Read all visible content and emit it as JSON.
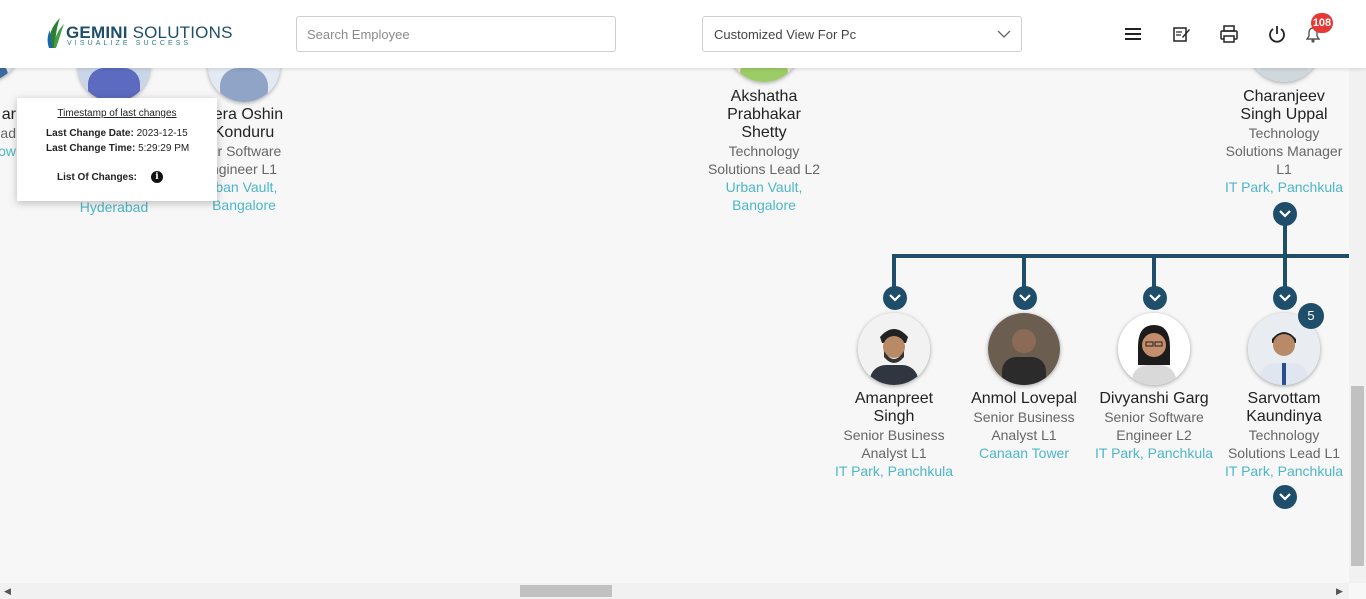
{
  "header": {
    "logo_name_bold": "GEMINI",
    "logo_name_rest": " SOLUTIONS",
    "logo_tagline": "VISUALIZE SUCCESS",
    "search_placeholder": "Search Employee",
    "view_select_value": "Customized View For Pc",
    "notification_count": "108",
    "icons": [
      "menu-icon",
      "edit-note-icon",
      "print-icon",
      "power-icon",
      "bell-icon"
    ]
  },
  "popup": {
    "title": "Timestamp of last changes",
    "date_label": "Last Change Date:",
    "date_value": "2023-12-15",
    "time_label": "Last Change Time:",
    "time_value": "5:29:29 PM",
    "changes_label": "List Of Changes:",
    "info_glyph": "i"
  },
  "top_row": {
    "partial_left": {
      "name": "ar",
      "designation": "ad",
      "location": "ow"
    },
    "hyderabad_location": "Hyderabad",
    "sameera": {
      "name_1": "hera Oshin",
      "name_2": "Konduru",
      "designation_1": "ior Software",
      "designation_2": "ngineer L1",
      "location_1": "rban Vault,",
      "location_2": "Bangalore"
    },
    "akshatha": {
      "name_1": "Akshatha",
      "name_2": "Prabhakar",
      "name_3": "Shetty",
      "designation_1": "Technology",
      "designation_2": "Solutions Lead L2",
      "location_1": "Urban Vault,",
      "location_2": "Bangalore"
    },
    "charanjeev": {
      "name_1": "Charanjeev",
      "name_2": "Singh Uppal",
      "designation_1": "Technology",
      "designation_2": "Solutions Manager",
      "designation_3": "L1",
      "location": "IT Park, Panchkula"
    }
  },
  "reports": [
    {
      "name_1": "Amanpreet",
      "name_2": "Singh",
      "designation_1": "Senior Business",
      "designation_2": "Analyst L1",
      "location": "IT Park, Panchkula"
    },
    {
      "name_1": "Anmol Lovepal",
      "designation_1": "Senior Business",
      "designation_2": "Analyst L1",
      "location": "Canaan Tower"
    },
    {
      "name_1": "Divyanshi Garg",
      "designation_1": "Senior Software",
      "designation_2": "Engineer L2",
      "location": "IT Park, Panchkula"
    },
    {
      "name_1": "Sarvottam",
      "name_2": "Kaundinya",
      "designation_1": "Technology",
      "designation_2": "Solutions Lead L1",
      "location": "IT Park, Panchkula",
      "report_count": "5"
    }
  ],
  "colors": {
    "connector": "#1f4e6b",
    "location_text": "#4db6c8",
    "badge": "#e53935"
  }
}
